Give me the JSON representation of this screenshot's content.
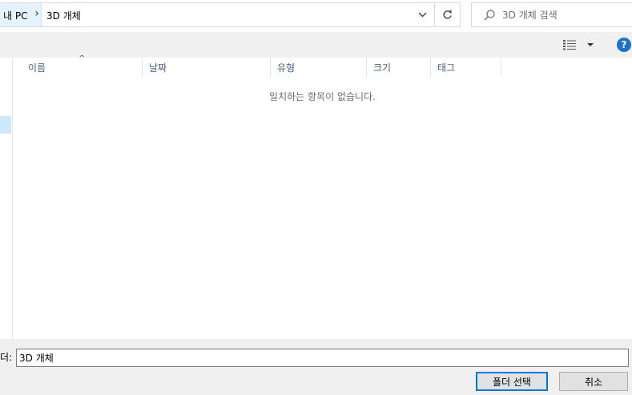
{
  "address_bar": {
    "root_crumb": "내 PC",
    "separator": "›",
    "current_folder": "3D 개체",
    "dropdown_icon": "chevron-down-icon",
    "refresh_icon": "refresh-icon"
  },
  "search": {
    "placeholder": "3D 개체 검색",
    "icon": "search-icon"
  },
  "command_bar": {
    "view_icon": "details-view-icon",
    "help_glyph": "?"
  },
  "columns": [
    {
      "label": "이름"
    },
    {
      "label": "날짜"
    },
    {
      "label": "유형"
    },
    {
      "label": "크기"
    },
    {
      "label": "태그"
    }
  ],
  "sort_indicator": "^",
  "empty_message": "일치하는 항목이 없습니다.",
  "footer": {
    "folder_label": "더:",
    "folder_value": "3D 개체",
    "select_button": "폴더 선택",
    "cancel_button": "취소"
  },
  "colors": {
    "accent": "#0078d7",
    "breadcrumb_highlight": "#e5f3ff",
    "header_text": "#4c607a",
    "help_badge": "#1a73c7"
  }
}
